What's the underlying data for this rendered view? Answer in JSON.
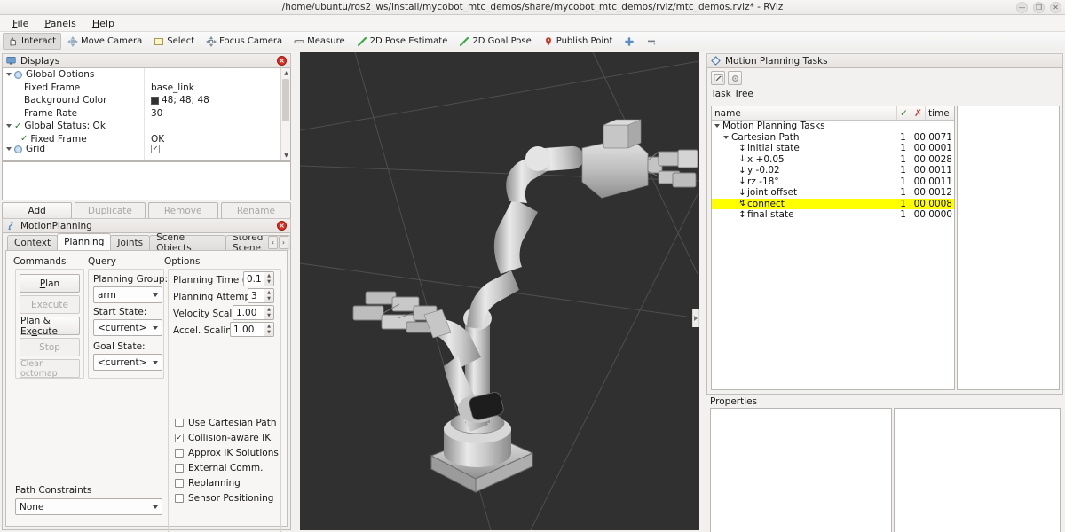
{
  "window": {
    "title": "/home/ubuntu/ros2_ws/install/mycobot_mtc_demos/share/mycobot_mtc_demos/rviz/mtc_demos.rviz* - RViz",
    "minimize": "—",
    "maximize": "❐",
    "close": "✕"
  },
  "menu": {
    "items": [
      {
        "label": "File"
      },
      {
        "label": "Panels"
      },
      {
        "label": "Help"
      }
    ]
  },
  "toolbar": {
    "buttons": [
      {
        "label": "Interact",
        "icon": "hand-icon",
        "active": true
      },
      {
        "label": "Move Camera",
        "icon": "move-camera-icon",
        "active": false
      },
      {
        "label": "Select",
        "icon": "select-rect-icon",
        "active": false
      },
      {
        "label": "Focus Camera",
        "icon": "focus-camera-icon",
        "active": false
      },
      {
        "label": "Measure",
        "icon": "measure-icon",
        "active": false
      },
      {
        "label": "2D Pose Estimate",
        "icon": "pose-arrow-icon",
        "active": false
      },
      {
        "label": "2D Goal Pose",
        "icon": "goal-arrow-icon",
        "active": false
      },
      {
        "label": "Publish Point",
        "icon": "map-pin-icon",
        "active": false
      },
      {
        "label": "",
        "icon": "move-plus-icon",
        "active": false
      },
      {
        "label": "",
        "icon": "toolbar-more-icon",
        "active": false
      }
    ]
  },
  "displays": {
    "title": "Displays",
    "rows": [
      {
        "name": "Global Options",
        "value": "",
        "indent": 0,
        "icon": "globe-icon",
        "expander": true
      },
      {
        "name": "Fixed Frame",
        "value": "base_link",
        "indent": 1,
        "icon": "",
        "expander": false
      },
      {
        "name": "Background Color",
        "value": "48; 48; 48",
        "indent": 1,
        "icon": "",
        "expander": false,
        "swatch": "#303030"
      },
      {
        "name": "Frame Rate",
        "value": "30",
        "indent": 1,
        "icon": "",
        "expander": false
      },
      {
        "name": "Global Status: Ok",
        "value": "",
        "indent": 0,
        "icon": "check-icon",
        "expander": true
      },
      {
        "name": "Fixed Frame",
        "value": "OK",
        "indent": 1,
        "icon": "check-icon",
        "expander": false
      },
      {
        "name": "Grid",
        "value": "",
        "indent": 0,
        "icon": "grid-icon",
        "expander": true
      }
    ],
    "buttons": [
      {
        "label": "Add",
        "enabled": true
      },
      {
        "label": "Duplicate",
        "enabled": false
      },
      {
        "label": "Remove",
        "enabled": false
      },
      {
        "label": "Rename",
        "enabled": false
      }
    ]
  },
  "motion_planning": {
    "title": "MotionPlanning",
    "tabs": [
      {
        "label": "Context",
        "selected": false
      },
      {
        "label": "Planning",
        "selected": true
      },
      {
        "label": "Joints",
        "selected": false
      },
      {
        "label": "Scene Objects",
        "selected": false
      },
      {
        "label": "Stored Scene",
        "selected": false
      }
    ],
    "commands": {
      "group_label": "Commands",
      "buttons": [
        {
          "label": "Plan",
          "enabled": true
        },
        {
          "label": "Execute",
          "enabled": false
        },
        {
          "label": "Plan & Execute",
          "enabled": true
        },
        {
          "label": "Stop",
          "enabled": false
        },
        {
          "label": "Clear octomap",
          "enabled": false
        }
      ]
    },
    "query": {
      "group_label": "Query",
      "fields": [
        {
          "label": "Planning Group:",
          "value": "arm"
        },
        {
          "label": "Start State:",
          "value": "<current>"
        },
        {
          "label": "Goal State:",
          "value": "<current>"
        }
      ]
    },
    "options": {
      "group_label": "Options",
      "spinners": [
        {
          "label": "Planning Time (s):",
          "value": "0.1"
        },
        {
          "label": "Planning Attempts:",
          "value": "3"
        },
        {
          "label": "Velocity Scaling:",
          "value": "1.00"
        },
        {
          "label": "Accel. Scaling:",
          "value": "1.00"
        }
      ],
      "checkboxes": [
        {
          "label": "Use Cartesian Path",
          "checked": false
        },
        {
          "label": "Collision-aware IK",
          "checked": true
        },
        {
          "label": "Approx IK Solutions",
          "checked": false
        },
        {
          "label": "External Comm.",
          "checked": false
        },
        {
          "label": "Replanning",
          "checked": false
        },
        {
          "label": "Sensor Positioning",
          "checked": false
        }
      ]
    },
    "path_constraints": {
      "label": "Path Constraints",
      "value": "None"
    }
  },
  "tasks_panel": {
    "title": "Motion Planning Tasks",
    "task_tree_label": "Task Tree",
    "columns": [
      {
        "label": "name"
      },
      {
        "label": "✓"
      },
      {
        "label": "✗"
      },
      {
        "label": "time"
      }
    ],
    "rows": [
      {
        "name": "Motion Planning Tasks",
        "indent": 0,
        "icon": "expander",
        "success": "",
        "failed": "",
        "time": "",
        "highlight": false
      },
      {
        "name": "Cartesian Path",
        "indent": 1,
        "icon": "expander",
        "success": "1",
        "failed": "0",
        "time": "0.0071",
        "highlight": false
      },
      {
        "name": "initial state",
        "indent": 2,
        "icon": "generator-icon",
        "success": "1",
        "failed": "0",
        "time": "0.0001",
        "highlight": false
      },
      {
        "name": "x +0.05",
        "indent": 2,
        "icon": "propagator-icon",
        "success": "1",
        "failed": "0",
        "time": "0.0028",
        "highlight": false
      },
      {
        "name": "y -0.02",
        "indent": 2,
        "icon": "propagator-icon",
        "success": "1",
        "failed": "0",
        "time": "0.0011",
        "highlight": false
      },
      {
        "name": "rz -18°",
        "indent": 2,
        "icon": "propagator-icon",
        "success": "1",
        "failed": "0",
        "time": "0.0011",
        "highlight": false
      },
      {
        "name": "joint offset",
        "indent": 2,
        "icon": "propagator-icon",
        "success": "1",
        "failed": "0",
        "time": "0.0012",
        "highlight": false
      },
      {
        "name": "connect",
        "indent": 2,
        "icon": "connector-icon",
        "success": "1",
        "failed": "0",
        "time": "0.0008",
        "highlight": true
      },
      {
        "name": "final state",
        "indent": 2,
        "icon": "generator-icon",
        "success": "1",
        "failed": "0",
        "time": "0.0000",
        "highlight": false
      }
    ],
    "tool_buttons": [
      {
        "icon": "exec-task-icon"
      },
      {
        "icon": "settings-gear-icon"
      }
    ]
  },
  "properties_panel": {
    "title": "Properties"
  },
  "viewport": {
    "background_color": "#303030",
    "grid_color": "#4a4a4a",
    "robot_color": "#c8c8c8"
  }
}
